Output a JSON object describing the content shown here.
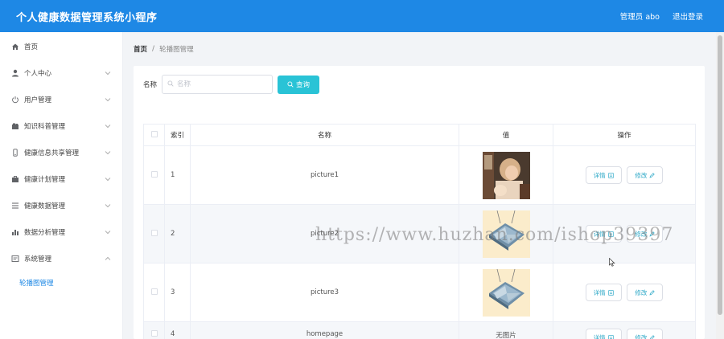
{
  "header": {
    "app_title": "个人健康数据管理系统小程序",
    "user": "管理员 abo",
    "logout": "退出登录"
  },
  "sidebar": {
    "items": [
      {
        "label": "首页",
        "icon": "home-icon"
      },
      {
        "label": "个人中心",
        "icon": "user-icon"
      },
      {
        "label": "用户管理",
        "icon": "power-icon"
      },
      {
        "label": "知识科普管理",
        "icon": "folder-icon"
      },
      {
        "label": "健康信息共享管理",
        "icon": "phone-icon"
      },
      {
        "label": "健康计划管理",
        "icon": "briefcase-icon"
      },
      {
        "label": "健康数据管理",
        "icon": "list-icon"
      },
      {
        "label": "数据分析管理",
        "icon": "bar-chart-icon"
      },
      {
        "label": "系统管理",
        "icon": "system-icon"
      }
    ],
    "sub_item": "轮播图管理"
  },
  "breadcrumb": {
    "home": "首页",
    "separator": "/",
    "current": "轮播图管理"
  },
  "search": {
    "label": "名称",
    "placeholder": "名称",
    "button": "查询"
  },
  "table": {
    "headers": [
      "索引",
      "名称",
      "值",
      "操作"
    ],
    "rows": [
      {
        "index": "1",
        "name": "picture1",
        "value": "image"
      },
      {
        "index": "2",
        "name": "picture2",
        "value": "image"
      },
      {
        "index": "3",
        "name": "picture3",
        "value": "image"
      },
      {
        "index": "4",
        "name": "homepage",
        "value": "无图片"
      }
    ],
    "detail_label": "详情",
    "edit_label": "修改"
  },
  "watermark": "https://www.huzhan.com/ishop39397",
  "colors": {
    "header_bg": "#1e88e5",
    "search_button": "#29c3d6",
    "active_menu": "#1e88e5"
  }
}
